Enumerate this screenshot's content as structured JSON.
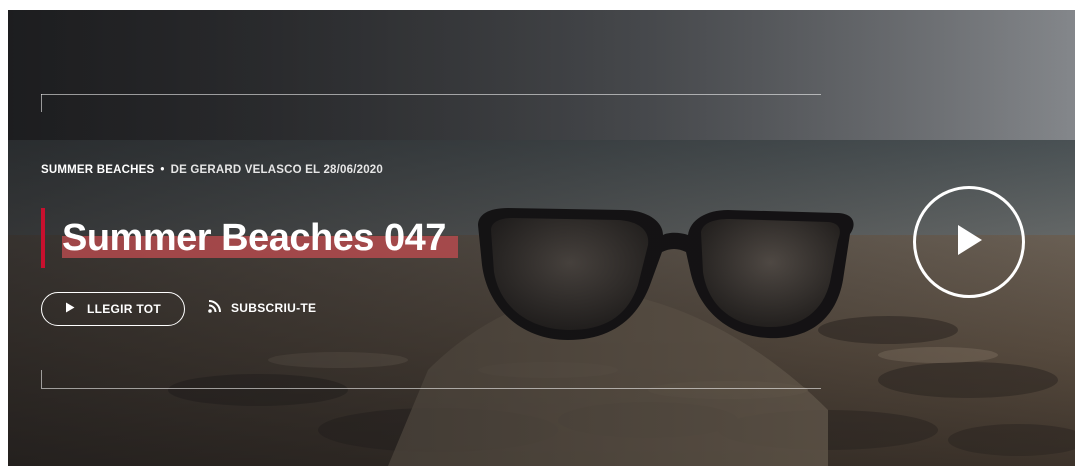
{
  "hero": {
    "category": "SUMMER BEACHES",
    "separator": "•",
    "byline": "DE GERARD VELASCO EL 28/06/2020",
    "title": "Summer Beaches 047",
    "read_button_label": "LLEGIR TOT",
    "subscribe_label": "SUBSCRIU-TE",
    "accent_color": "#c8102e",
    "highlight_color": "#be4b50",
    "icons": {
      "read": "play-icon",
      "subscribe": "rss-icon",
      "player": "play-circle-icon"
    }
  }
}
